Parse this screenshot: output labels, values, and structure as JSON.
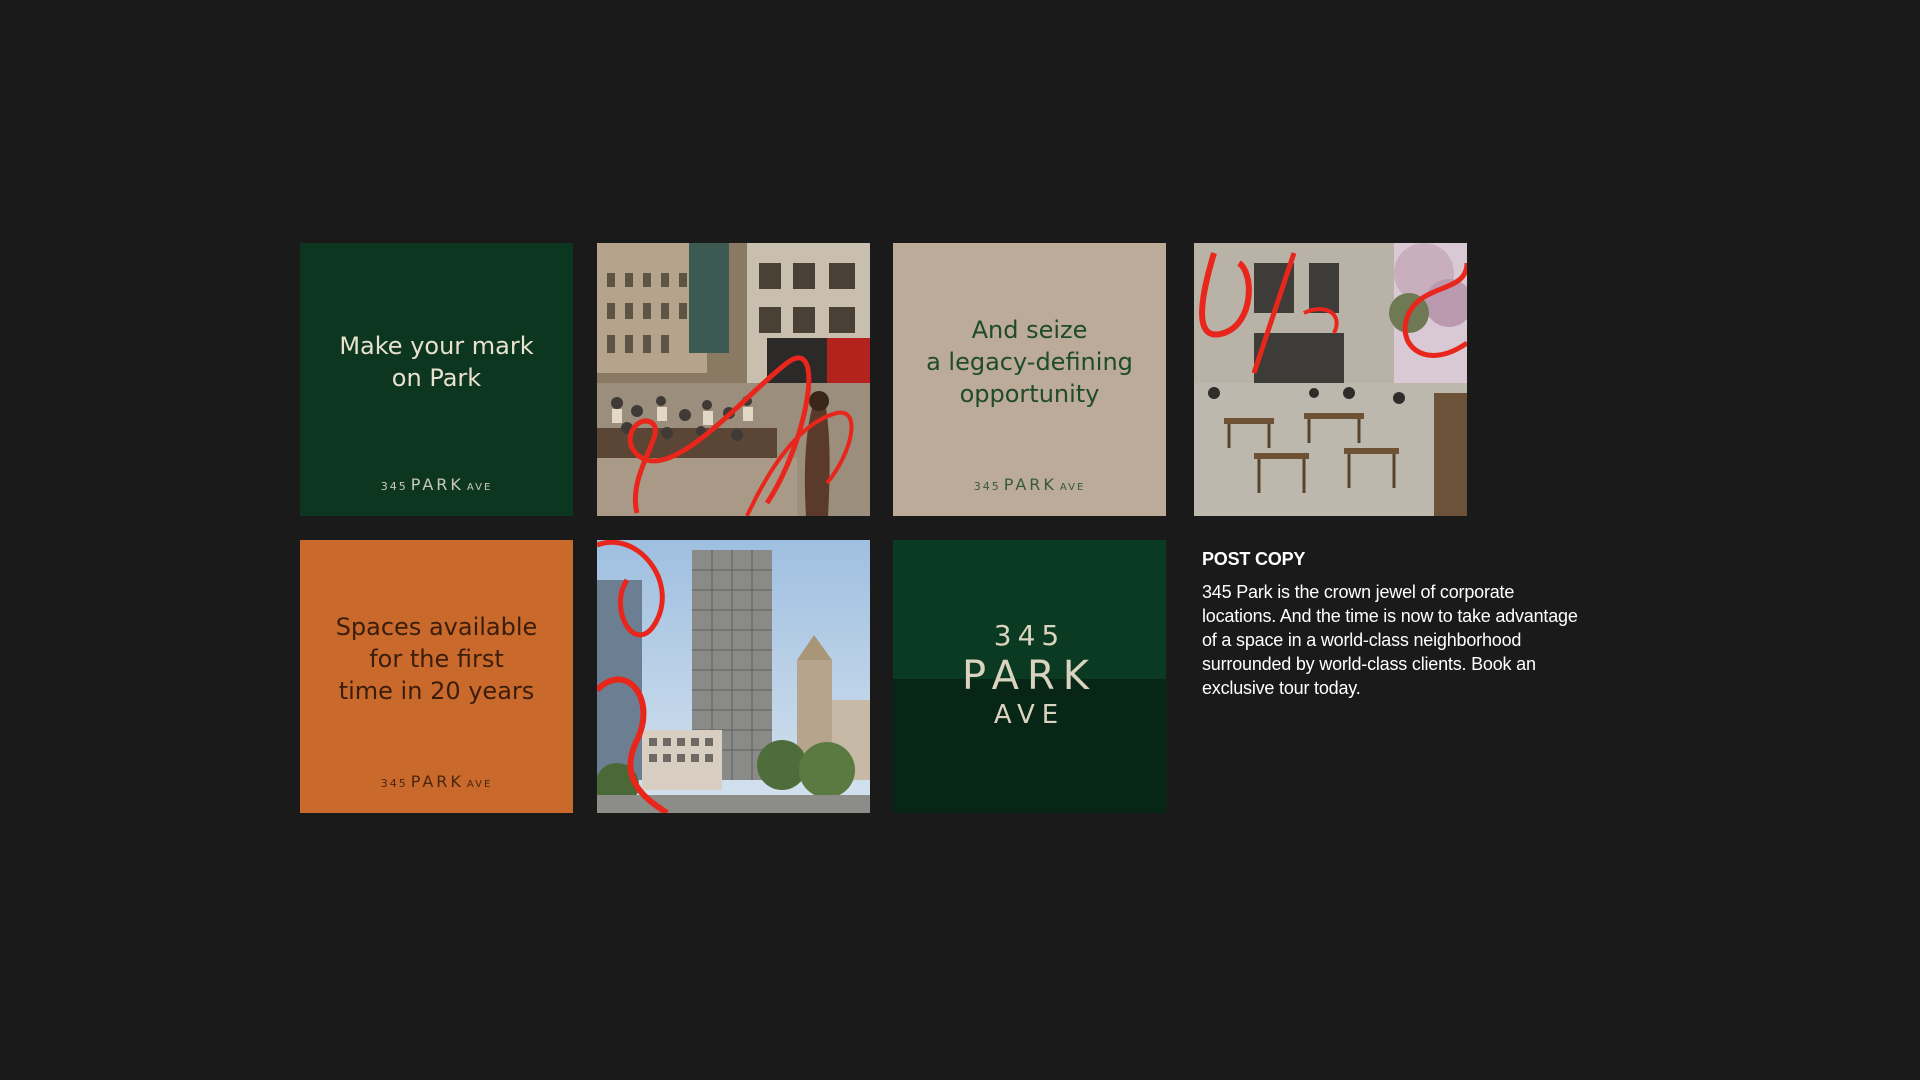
{
  "colors": {
    "background": "#1a1a1a",
    "dark_green": "#0d3620",
    "beige": "#bcab98",
    "orange": "#c9692c",
    "accent_red": "#e8261c"
  },
  "tiles": [
    {
      "type": "text",
      "headline": "Make your mark\non Park",
      "logo": {
        "num": "345",
        "park": "PARK",
        "ave": "AVE"
      }
    },
    {
      "type": "photo",
      "icon": "plaza-photo-icon"
    },
    {
      "type": "text",
      "headline": "And seize\na legacy-defining\nopportunity",
      "logo": {
        "num": "345",
        "park": "PARK",
        "ave": "AVE"
      }
    },
    {
      "type": "photo",
      "icon": "cafe-terrace-photo-icon"
    },
    {
      "type": "text",
      "headline": "Spaces available\nfor the first\ntime in 20 years",
      "logo": {
        "num": "345",
        "park": "PARK",
        "ave": "AVE"
      }
    },
    {
      "type": "photo",
      "icon": "tower-photo-icon"
    },
    {
      "type": "logo",
      "logo": {
        "num": "345",
        "park": "PARK",
        "ave": "AVE"
      }
    }
  ],
  "post": {
    "title": "POST COPY",
    "body": "345 Park is the crown jewel of corporate locations. And the time is now to take advantage of a space in a world-class neighborhood surrounded by world-class clients. Book an exclusive tour today."
  }
}
